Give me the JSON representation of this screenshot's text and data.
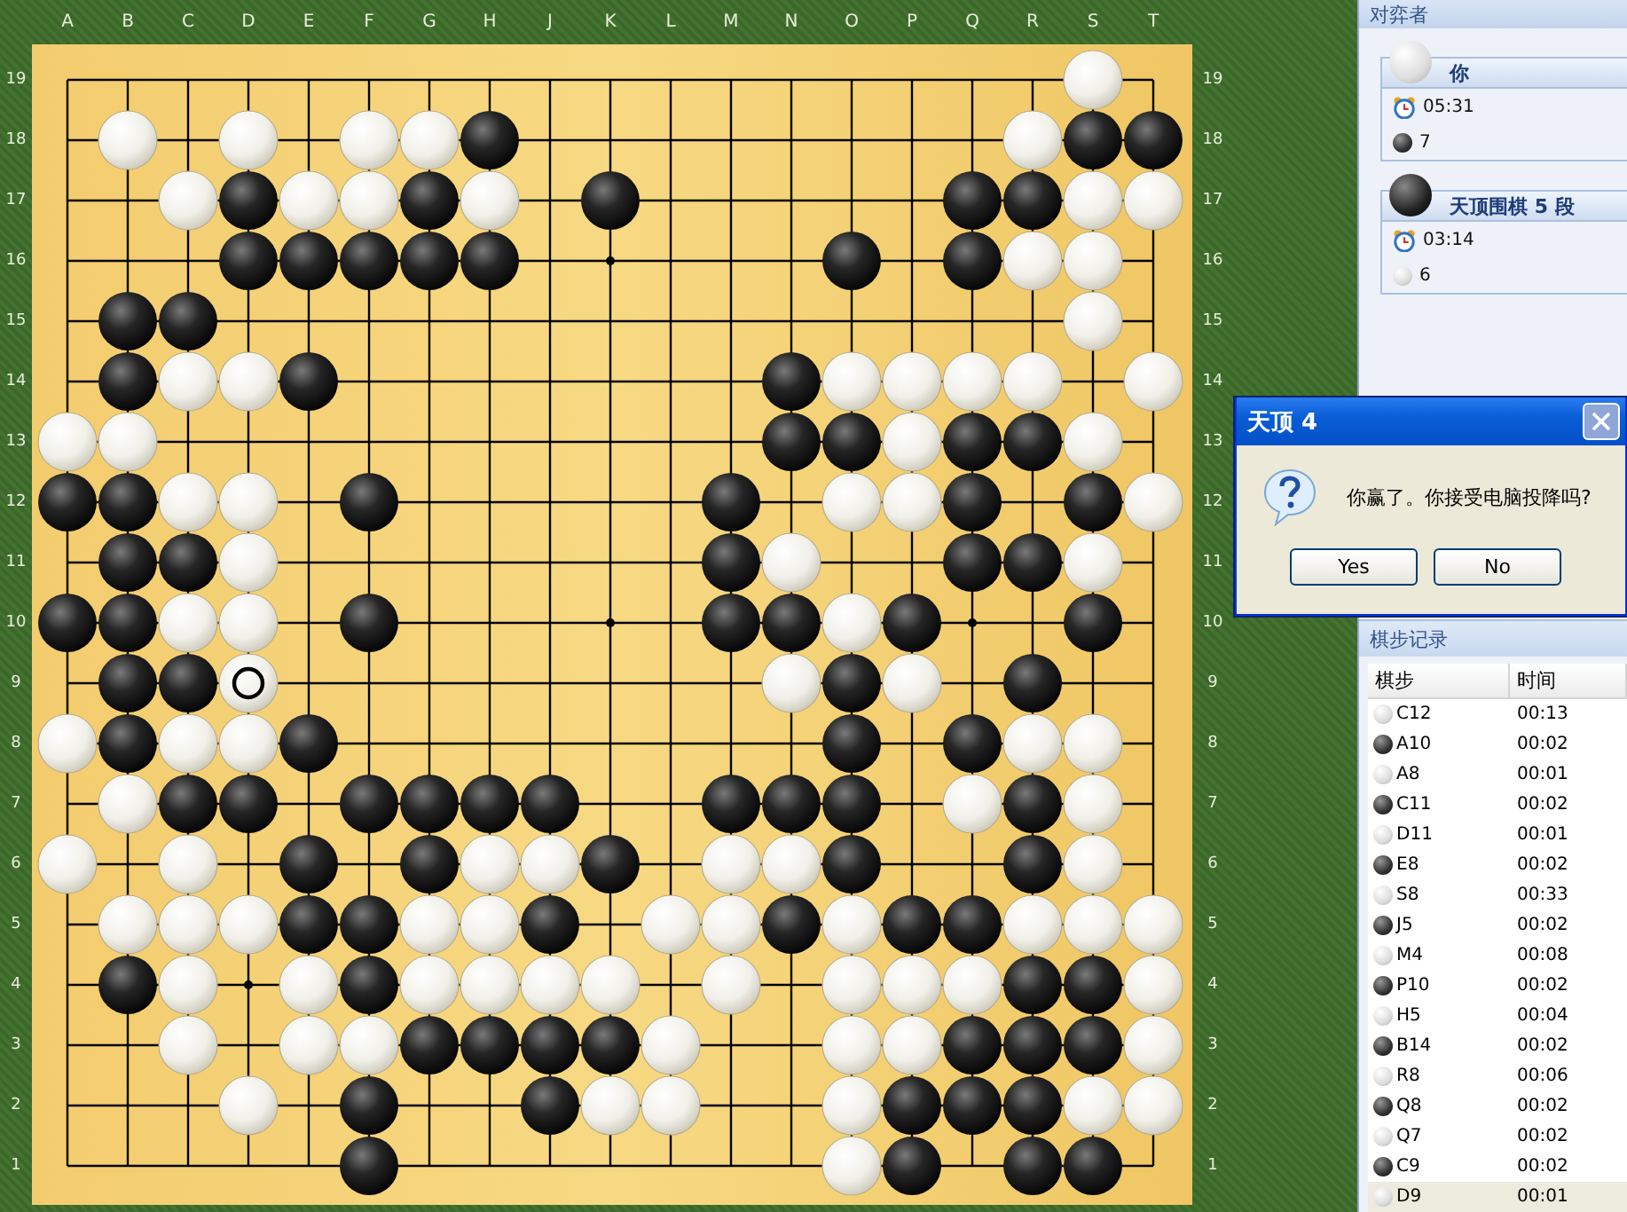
{
  "coordinates": {
    "columns": [
      "A",
      "B",
      "C",
      "D",
      "E",
      "F",
      "G",
      "H",
      "J",
      "K",
      "L",
      "M",
      "N",
      "O",
      "P",
      "Q",
      "R",
      "S",
      "T"
    ],
    "left_rows": [
      "19",
      "18",
      "17",
      "16",
      "15",
      "14",
      "13",
      "12",
      "11",
      "10",
      "9",
      "8",
      "7",
      "6",
      "5",
      "4",
      "3",
      "2",
      "1"
    ],
    "right_rows": [
      "19",
      "18",
      "17",
      "16",
      "15",
      "14",
      "13",
      "12",
      "11",
      "10",
      "9",
      "8",
      "7",
      "6",
      "5",
      "4",
      "3",
      "2",
      "1"
    ]
  },
  "board": {
    "rows": [
      {
        "cells": [
          {
            "kind": "none"
          },
          {
            "kind": "none"
          },
          {
            "kind": "none"
          },
          {
            "kind": "none"
          },
          {
            "kind": "none"
          },
          {
            "kind": "none"
          },
          {
            "kind": "none"
          },
          {
            "kind": "none"
          },
          {
            "kind": "none"
          },
          {
            "kind": "none"
          },
          {
            "kind": "none"
          },
          {
            "kind": "none"
          },
          {
            "kind": "none"
          },
          {
            "kind": "none"
          },
          {
            "kind": "none"
          },
          {
            "kind": "none"
          },
          {
            "kind": "none"
          },
          {
            "kind": "white"
          },
          {
            "kind": "none"
          }
        ]
      },
      {
        "cells": [
          {
            "kind": "none"
          },
          {
            "kind": "white"
          },
          {
            "kind": "none"
          },
          {
            "kind": "white"
          },
          {
            "kind": "none"
          },
          {
            "kind": "white"
          },
          {
            "kind": "white"
          },
          {
            "kind": "black"
          },
          {
            "kind": "none"
          },
          {
            "kind": "none"
          },
          {
            "kind": "none"
          },
          {
            "kind": "none"
          },
          {
            "kind": "none"
          },
          {
            "kind": "none"
          },
          {
            "kind": "none"
          },
          {
            "kind": "none"
          },
          {
            "kind": "white"
          },
          {
            "kind": "black"
          },
          {
            "kind": "black"
          }
        ]
      },
      {
        "cells": [
          {
            "kind": "none"
          },
          {
            "kind": "none"
          },
          {
            "kind": "white"
          },
          {
            "kind": "black"
          },
          {
            "kind": "white"
          },
          {
            "kind": "white"
          },
          {
            "kind": "black"
          },
          {
            "kind": "white"
          },
          {
            "kind": "none"
          },
          {
            "kind": "black"
          },
          {
            "kind": "none"
          },
          {
            "kind": "none"
          },
          {
            "kind": "none"
          },
          {
            "kind": "none"
          },
          {
            "kind": "none"
          },
          {
            "kind": "black"
          },
          {
            "kind": "black"
          },
          {
            "kind": "white"
          },
          {
            "kind": "white"
          }
        ]
      },
      {
        "cells": [
          {
            "kind": "none"
          },
          {
            "kind": "none"
          },
          {
            "kind": "none"
          },
          {
            "kind": "black"
          },
          {
            "kind": "black"
          },
          {
            "kind": "black"
          },
          {
            "kind": "black"
          },
          {
            "kind": "black"
          },
          {
            "kind": "none"
          },
          {
            "kind": "none"
          },
          {
            "kind": "none"
          },
          {
            "kind": "none"
          },
          {
            "kind": "none"
          },
          {
            "kind": "black"
          },
          {
            "kind": "none"
          },
          {
            "kind": "black"
          },
          {
            "kind": "white"
          },
          {
            "kind": "white"
          },
          {
            "kind": "none"
          }
        ]
      },
      {
        "cells": [
          {
            "kind": "none"
          },
          {
            "kind": "black"
          },
          {
            "kind": "black"
          },
          {
            "kind": "none"
          },
          {
            "kind": "none"
          },
          {
            "kind": "none"
          },
          {
            "kind": "none"
          },
          {
            "kind": "none"
          },
          {
            "kind": "none"
          },
          {
            "kind": "none"
          },
          {
            "kind": "none"
          },
          {
            "kind": "none"
          },
          {
            "kind": "none"
          },
          {
            "kind": "none"
          },
          {
            "kind": "none"
          },
          {
            "kind": "none"
          },
          {
            "kind": "none"
          },
          {
            "kind": "white"
          },
          {
            "kind": "none"
          }
        ]
      },
      {
        "cells": [
          {
            "kind": "none"
          },
          {
            "kind": "black"
          },
          {
            "kind": "white"
          },
          {
            "kind": "white"
          },
          {
            "kind": "black"
          },
          {
            "kind": "none"
          },
          {
            "kind": "none"
          },
          {
            "kind": "none"
          },
          {
            "kind": "none"
          },
          {
            "kind": "none"
          },
          {
            "kind": "none"
          },
          {
            "kind": "none"
          },
          {
            "kind": "black"
          },
          {
            "kind": "white"
          },
          {
            "kind": "white"
          },
          {
            "kind": "white"
          },
          {
            "kind": "white"
          },
          {
            "kind": "none"
          },
          {
            "kind": "white"
          }
        ]
      },
      {
        "cells": [
          {
            "kind": "white"
          },
          {
            "kind": "white"
          },
          {
            "kind": "none"
          },
          {
            "kind": "none"
          },
          {
            "kind": "none"
          },
          {
            "kind": "none"
          },
          {
            "kind": "none"
          },
          {
            "kind": "none"
          },
          {
            "kind": "none"
          },
          {
            "kind": "none"
          },
          {
            "kind": "none"
          },
          {
            "kind": "none"
          },
          {
            "kind": "black"
          },
          {
            "kind": "black"
          },
          {
            "kind": "white"
          },
          {
            "kind": "black"
          },
          {
            "kind": "black"
          },
          {
            "kind": "white"
          },
          {
            "kind": "none"
          }
        ]
      },
      {
        "cells": [
          {
            "kind": "black"
          },
          {
            "kind": "black"
          },
          {
            "kind": "white"
          },
          {
            "kind": "white"
          },
          {
            "kind": "none"
          },
          {
            "kind": "black"
          },
          {
            "kind": "none"
          },
          {
            "kind": "none"
          },
          {
            "kind": "none"
          },
          {
            "kind": "none"
          },
          {
            "kind": "none"
          },
          {
            "kind": "black"
          },
          {
            "kind": "none"
          },
          {
            "kind": "white"
          },
          {
            "kind": "white"
          },
          {
            "kind": "black"
          },
          {
            "kind": "none"
          },
          {
            "kind": "black"
          },
          {
            "kind": "white"
          }
        ]
      },
      {
        "cells": [
          {
            "kind": "none"
          },
          {
            "kind": "black"
          },
          {
            "kind": "black"
          },
          {
            "kind": "white"
          },
          {
            "kind": "none"
          },
          {
            "kind": "none"
          },
          {
            "kind": "none"
          },
          {
            "kind": "none"
          },
          {
            "kind": "none"
          },
          {
            "kind": "none"
          },
          {
            "kind": "none"
          },
          {
            "kind": "black"
          },
          {
            "kind": "white"
          },
          {
            "kind": "none"
          },
          {
            "kind": "none"
          },
          {
            "kind": "black"
          },
          {
            "kind": "black"
          },
          {
            "kind": "white"
          },
          {
            "kind": "none"
          }
        ]
      },
      {
        "cells": [
          {
            "kind": "black"
          },
          {
            "kind": "black"
          },
          {
            "kind": "white"
          },
          {
            "kind": "white"
          },
          {
            "kind": "none"
          },
          {
            "kind": "black"
          },
          {
            "kind": "none"
          },
          {
            "kind": "none"
          },
          {
            "kind": "none"
          },
          {
            "kind": "none"
          },
          {
            "kind": "none"
          },
          {
            "kind": "black"
          },
          {
            "kind": "black"
          },
          {
            "kind": "white"
          },
          {
            "kind": "black"
          },
          {
            "kind": "none"
          },
          {
            "kind": "none"
          },
          {
            "kind": "black"
          },
          {
            "kind": "none"
          }
        ]
      },
      {
        "cells": [
          {
            "kind": "none"
          },
          {
            "kind": "black"
          },
          {
            "kind": "black"
          },
          {
            "kind": "last"
          },
          {
            "kind": "none"
          },
          {
            "kind": "none"
          },
          {
            "kind": "none"
          },
          {
            "kind": "none"
          },
          {
            "kind": "none"
          },
          {
            "kind": "none"
          },
          {
            "kind": "none"
          },
          {
            "kind": "none"
          },
          {
            "kind": "white"
          },
          {
            "kind": "black"
          },
          {
            "kind": "white"
          },
          {
            "kind": "none"
          },
          {
            "kind": "black"
          },
          {
            "kind": "none"
          },
          {
            "kind": "none"
          }
        ]
      },
      {
        "cells": [
          {
            "kind": "white"
          },
          {
            "kind": "black"
          },
          {
            "kind": "white"
          },
          {
            "kind": "white"
          },
          {
            "kind": "black"
          },
          {
            "kind": "none"
          },
          {
            "kind": "none"
          },
          {
            "kind": "none"
          },
          {
            "kind": "none"
          },
          {
            "kind": "none"
          },
          {
            "kind": "none"
          },
          {
            "kind": "none"
          },
          {
            "kind": "none"
          },
          {
            "kind": "black"
          },
          {
            "kind": "none"
          },
          {
            "kind": "black"
          },
          {
            "kind": "white"
          },
          {
            "kind": "white"
          },
          {
            "kind": "none"
          }
        ]
      },
      {
        "cells": [
          {
            "kind": "none"
          },
          {
            "kind": "white"
          },
          {
            "kind": "black"
          },
          {
            "kind": "black"
          },
          {
            "kind": "none"
          },
          {
            "kind": "black"
          },
          {
            "kind": "black"
          },
          {
            "kind": "black"
          },
          {
            "kind": "black"
          },
          {
            "kind": "none"
          },
          {
            "kind": "none"
          },
          {
            "kind": "black"
          },
          {
            "kind": "black"
          },
          {
            "kind": "black"
          },
          {
            "kind": "none"
          },
          {
            "kind": "white"
          },
          {
            "kind": "black"
          },
          {
            "kind": "white"
          },
          {
            "kind": "none"
          }
        ]
      },
      {
        "cells": [
          {
            "kind": "white"
          },
          {
            "kind": "none"
          },
          {
            "kind": "white"
          },
          {
            "kind": "none"
          },
          {
            "kind": "black"
          },
          {
            "kind": "none"
          },
          {
            "kind": "black"
          },
          {
            "kind": "white"
          },
          {
            "kind": "white"
          },
          {
            "kind": "black"
          },
          {
            "kind": "none"
          },
          {
            "kind": "white"
          },
          {
            "kind": "white"
          },
          {
            "kind": "black"
          },
          {
            "kind": "none"
          },
          {
            "kind": "none"
          },
          {
            "kind": "black"
          },
          {
            "kind": "white"
          },
          {
            "kind": "none"
          }
        ]
      },
      {
        "cells": [
          {
            "kind": "none"
          },
          {
            "kind": "white"
          },
          {
            "kind": "white"
          },
          {
            "kind": "white"
          },
          {
            "kind": "black"
          },
          {
            "kind": "black"
          },
          {
            "kind": "white"
          },
          {
            "kind": "white"
          },
          {
            "kind": "black"
          },
          {
            "kind": "none"
          },
          {
            "kind": "white"
          },
          {
            "kind": "white"
          },
          {
            "kind": "black"
          },
          {
            "kind": "white"
          },
          {
            "kind": "black"
          },
          {
            "kind": "black"
          },
          {
            "kind": "white"
          },
          {
            "kind": "white"
          },
          {
            "kind": "white"
          }
        ]
      },
      {
        "cells": [
          {
            "kind": "none"
          },
          {
            "kind": "black"
          },
          {
            "kind": "white"
          },
          {
            "kind": "none"
          },
          {
            "kind": "white"
          },
          {
            "kind": "black"
          },
          {
            "kind": "white"
          },
          {
            "kind": "white"
          },
          {
            "kind": "white"
          },
          {
            "kind": "white"
          },
          {
            "kind": "none"
          },
          {
            "kind": "white"
          },
          {
            "kind": "none"
          },
          {
            "kind": "white"
          },
          {
            "kind": "white"
          },
          {
            "kind": "white"
          },
          {
            "kind": "black"
          },
          {
            "kind": "black"
          },
          {
            "kind": "white"
          }
        ]
      },
      {
        "cells": [
          {
            "kind": "none"
          },
          {
            "kind": "none"
          },
          {
            "kind": "white"
          },
          {
            "kind": "none"
          },
          {
            "kind": "white"
          },
          {
            "kind": "white"
          },
          {
            "kind": "black"
          },
          {
            "kind": "black"
          },
          {
            "kind": "black"
          },
          {
            "kind": "black"
          },
          {
            "kind": "white"
          },
          {
            "kind": "none"
          },
          {
            "kind": "none"
          },
          {
            "kind": "white"
          },
          {
            "kind": "white"
          },
          {
            "kind": "black"
          },
          {
            "kind": "black"
          },
          {
            "kind": "black"
          },
          {
            "kind": "white"
          }
        ]
      },
      {
        "cells": [
          {
            "kind": "none"
          },
          {
            "kind": "none"
          },
          {
            "kind": "none"
          },
          {
            "kind": "white"
          },
          {
            "kind": "none"
          },
          {
            "kind": "black"
          },
          {
            "kind": "none"
          },
          {
            "kind": "none"
          },
          {
            "kind": "black"
          },
          {
            "kind": "white"
          },
          {
            "kind": "white"
          },
          {
            "kind": "none"
          },
          {
            "kind": "none"
          },
          {
            "kind": "white"
          },
          {
            "kind": "black"
          },
          {
            "kind": "black"
          },
          {
            "kind": "black"
          },
          {
            "kind": "white"
          },
          {
            "kind": "white"
          }
        ]
      },
      {
        "cells": [
          {
            "kind": "none"
          },
          {
            "kind": "none"
          },
          {
            "kind": "none"
          },
          {
            "kind": "none"
          },
          {
            "kind": "none"
          },
          {
            "kind": "black"
          },
          {
            "kind": "none"
          },
          {
            "kind": "none"
          },
          {
            "kind": "none"
          },
          {
            "kind": "none"
          },
          {
            "kind": "none"
          },
          {
            "kind": "none"
          },
          {
            "kind": "none"
          },
          {
            "kind": "white"
          },
          {
            "kind": "black"
          },
          {
            "kind": "none"
          },
          {
            "kind": "black"
          },
          {
            "kind": "black"
          },
          {
            "kind": "none"
          }
        ]
      }
    ]
  },
  "players_panel": {
    "title": "对弈者",
    "players": [
      {
        "kind": "white",
        "name": "你",
        "time": "05:31",
        "captures_icon": {
          "kind": "black"
        },
        "captures": "7"
      },
      {
        "kind": "black",
        "name": "天顶围棋 5 段",
        "time": "03:14",
        "captures_icon": {
          "kind": "white"
        },
        "captures": "6"
      }
    ]
  },
  "dialog": {
    "title": "天顶 4",
    "message": "你赢了。你接受电脑投降吗?",
    "buttons": [
      "Yes",
      "No"
    ]
  },
  "moves_panel": {
    "title": "棋步记录",
    "columns": [
      "棋步",
      "时间"
    ],
    "moves": [
      {
        "kind": "white",
        "move": "C12",
        "time": "00:13",
        "selected": false
      },
      {
        "kind": "black",
        "move": "A10",
        "time": "00:02",
        "selected": false
      },
      {
        "kind": "white",
        "move": "A8",
        "time": "00:01",
        "selected": false
      },
      {
        "kind": "black",
        "move": "C11",
        "time": "00:02",
        "selected": false
      },
      {
        "kind": "white",
        "move": "D11",
        "time": "00:01",
        "selected": false
      },
      {
        "kind": "black",
        "move": "E8",
        "time": "00:02",
        "selected": false
      },
      {
        "kind": "white",
        "move": "S8",
        "time": "00:33",
        "selected": false
      },
      {
        "kind": "black",
        "move": "J5",
        "time": "00:02",
        "selected": false
      },
      {
        "kind": "white",
        "move": "M4",
        "time": "00:08",
        "selected": false
      },
      {
        "kind": "black",
        "move": "P10",
        "time": "00:02",
        "selected": false
      },
      {
        "kind": "white",
        "move": "H5",
        "time": "00:04",
        "selected": false
      },
      {
        "kind": "black",
        "move": "B14",
        "time": "00:02",
        "selected": false
      },
      {
        "kind": "white",
        "move": "R8",
        "time": "00:06",
        "selected": false
      },
      {
        "kind": "black",
        "move": "Q8",
        "time": "00:02",
        "selected": false
      },
      {
        "kind": "white",
        "move": "Q7",
        "time": "00:02",
        "selected": false
      },
      {
        "kind": "black",
        "move": "C9",
        "time": "00:02",
        "selected": false
      },
      {
        "kind": "white",
        "move": "D9",
        "time": "00:01",
        "selected": true
      }
    ]
  }
}
